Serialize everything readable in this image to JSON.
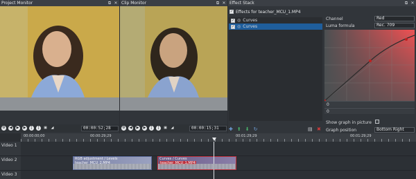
{
  "project_monitor": {
    "title": "Project Monitor",
    "timecode": "00:00:52;28"
  },
  "clip_monitor": {
    "title": "Clip Monitor",
    "timecode": "00:00:15;31"
  },
  "effect_stack": {
    "title": "Effect Stack",
    "clip_label": "Effects for teacher_MCU_1.MP4",
    "effects": [
      {
        "name": "Curves",
        "selected": false
      },
      {
        "name": "Curves",
        "selected": true
      }
    ],
    "channel_label": "Channel",
    "channel_value": "Red",
    "luma_label": "Luma formula",
    "luma_value": "Rec. 709",
    "slider_values": [
      "0",
      "0"
    ],
    "show_graph_label": "Show graph in picture",
    "graph_position_label": "Graph position",
    "graph_position_value": "Bottom Right"
  },
  "timeline": {
    "ruler_labels": [
      "00:00:00;00",
      "00:00:29;29",
      "00:01:29;29",
      "00:01:29;29"
    ],
    "tracks": [
      {
        "label": "Video 1"
      },
      {
        "label": "Video 2"
      },
      {
        "label": "Video 3"
      }
    ],
    "clips": [
      {
        "title": "RGB adjustment / Levels"
      },
      {
        "title": "teacher_MCU_2.MP4"
      },
      {
        "title": "Curves / Curves"
      },
      {
        "title": "teacher_MCU_1.MP4"
      }
    ]
  },
  "icons": [
    "close-icon",
    "float-icon",
    "play-icon",
    "rewind-icon",
    "forward-icon",
    "volume-icon",
    "fit-icon",
    "add-effect-icon",
    "reset-icon",
    "delete-icon"
  ],
  "colors": {
    "selection": "#1f5e9c",
    "panel": "#31353a",
    "clip_red_border": "#c0313d"
  }
}
